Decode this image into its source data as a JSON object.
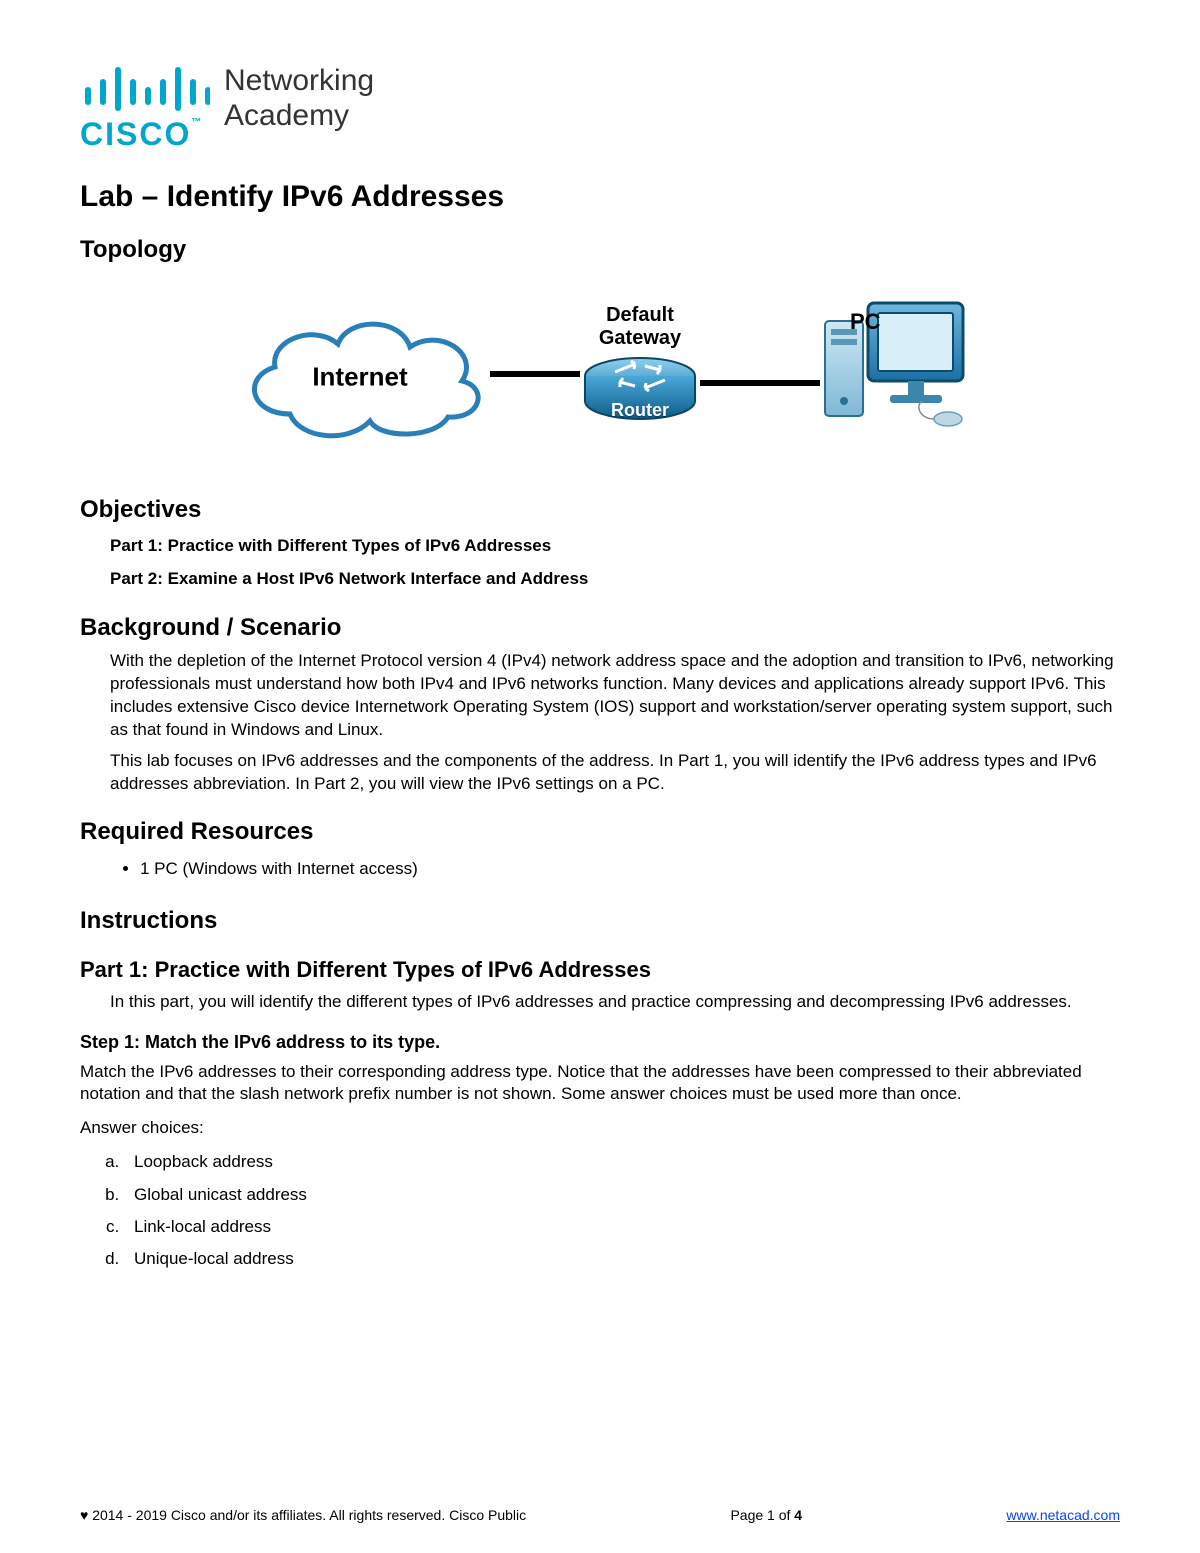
{
  "logo": {
    "brand": "CISCO",
    "line1": "Networking",
    "line2": "Academy"
  },
  "title": "Lab – Identify IPv6 Addresses",
  "sections": {
    "topology": "Topology",
    "objectives": "Objectives",
    "background": "Background / Scenario",
    "resources": "Required Resources",
    "instructions": "Instructions"
  },
  "topology": {
    "internet": "Internet",
    "gateway_label": "Default\nGateway",
    "router_label": "Router",
    "pc_label": "PC"
  },
  "objectives": {
    "part1": "Part 1: Practice with Different Types of IPv6 Addresses",
    "part2": "Part 2: Examine a Host IPv6 Network Interface and Address"
  },
  "background": {
    "p1": "With the depletion of the Internet Protocol version 4 (IPv4) network address space and the adoption and transition to IPv6, networking professionals must understand how both IPv4 and IPv6 networks function. Many devices and applications already support IPv6. This includes extensive Cisco device Internetwork Operating System (IOS) support and workstation/server operating system support, such as that found in Windows and Linux.",
    "p2": "This lab focuses on IPv6 addresses and the components of the address. In Part 1, you will identify the IPv6 address types and IPv6 addresses abbreviation. In Part 2, you will view the IPv6 settings on a PC."
  },
  "resources": {
    "items": [
      "1 PC (Windows with Internet access)"
    ]
  },
  "part1": {
    "heading": "Part 1: Practice with Different Types of IPv6 Addresses",
    "intro": "In this part, you will identify the different types of IPv6 addresses and practice compressing and decompressing IPv6 addresses.",
    "step1_heading": "Step 1: Match the IPv6 address to its type.",
    "step1_body": "Match the IPv6 addresses to their corresponding address type. Notice that the addresses have been compressed to their abbreviated notation and that the slash network prefix number is not shown. Some answer choices must be used more than once.",
    "answer_label": "Answer choices:",
    "choices": [
      "Loopback address",
      "Global unicast address",
      "Link-local address",
      " Unique-local address"
    ]
  },
  "footer": {
    "copyright": "♥ 2014 - 2019 Cisco and/or its affiliates. All rights reserved. Cisco Public",
    "page": "Page 1 of 4",
    "link": "www.netacad.com"
  }
}
